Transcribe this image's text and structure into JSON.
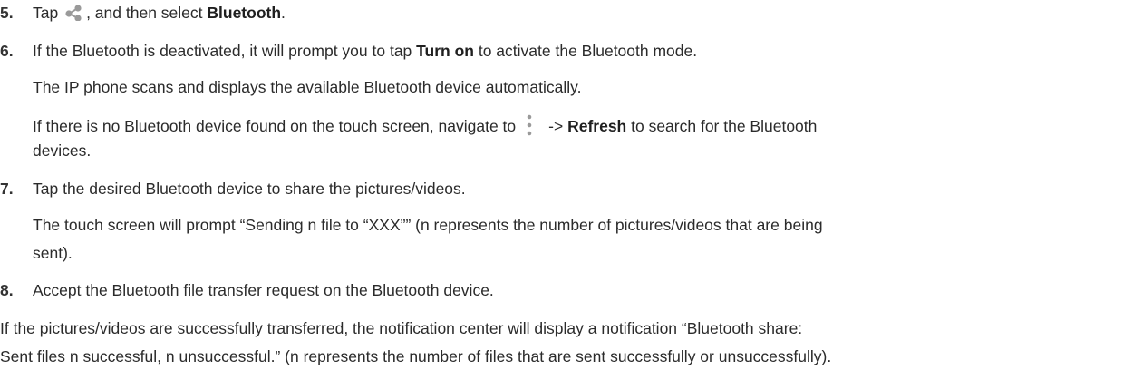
{
  "steps": [
    {
      "number": "5.",
      "before_icon": "Tap ",
      "icon": "share-icon",
      "after_icon": ", and then select ",
      "bold": "Bluetooth",
      "end": "."
    },
    {
      "number": "6.",
      "line1_before": "If the Bluetooth is deactivated, it will prompt you to tap ",
      "line1_bold": "Turn on",
      "line1_after": " to activate the Bluetooth mode.",
      "line2": "The IP phone scans and displays the available Bluetooth device automatically.",
      "line3_before": "If there is no Bluetooth device found on the touch screen, navigate to",
      "line3_icon": "more-vertical-icon",
      "line3_arrow": "->",
      "line3_bold": "Refresh",
      "line3_after": " to search for the Bluetooth",
      "line4": "devices."
    },
    {
      "number": "7.",
      "line1": "Tap the desired Bluetooth device to share the pictures/videos.",
      "line2": "The touch screen will prompt “Sending n file to “XXX”” (n represents the number of pictures/videos that are being",
      "line3": "sent)."
    },
    {
      "number": "8.",
      "line1": "Accept the Bluetooth file transfer request on the Bluetooth device."
    }
  ],
  "footer": {
    "line1": "If the pictures/videos are successfully transferred, the notification center will display a notification “Bluetooth share:",
    "line2": "Sent files n successful, n unsuccessful.” (n represents the number of files that are sent successfully or unsuccessfully)."
  },
  "colors": {
    "text": "#2b2b2b",
    "icon": "#9a9a9a"
  }
}
